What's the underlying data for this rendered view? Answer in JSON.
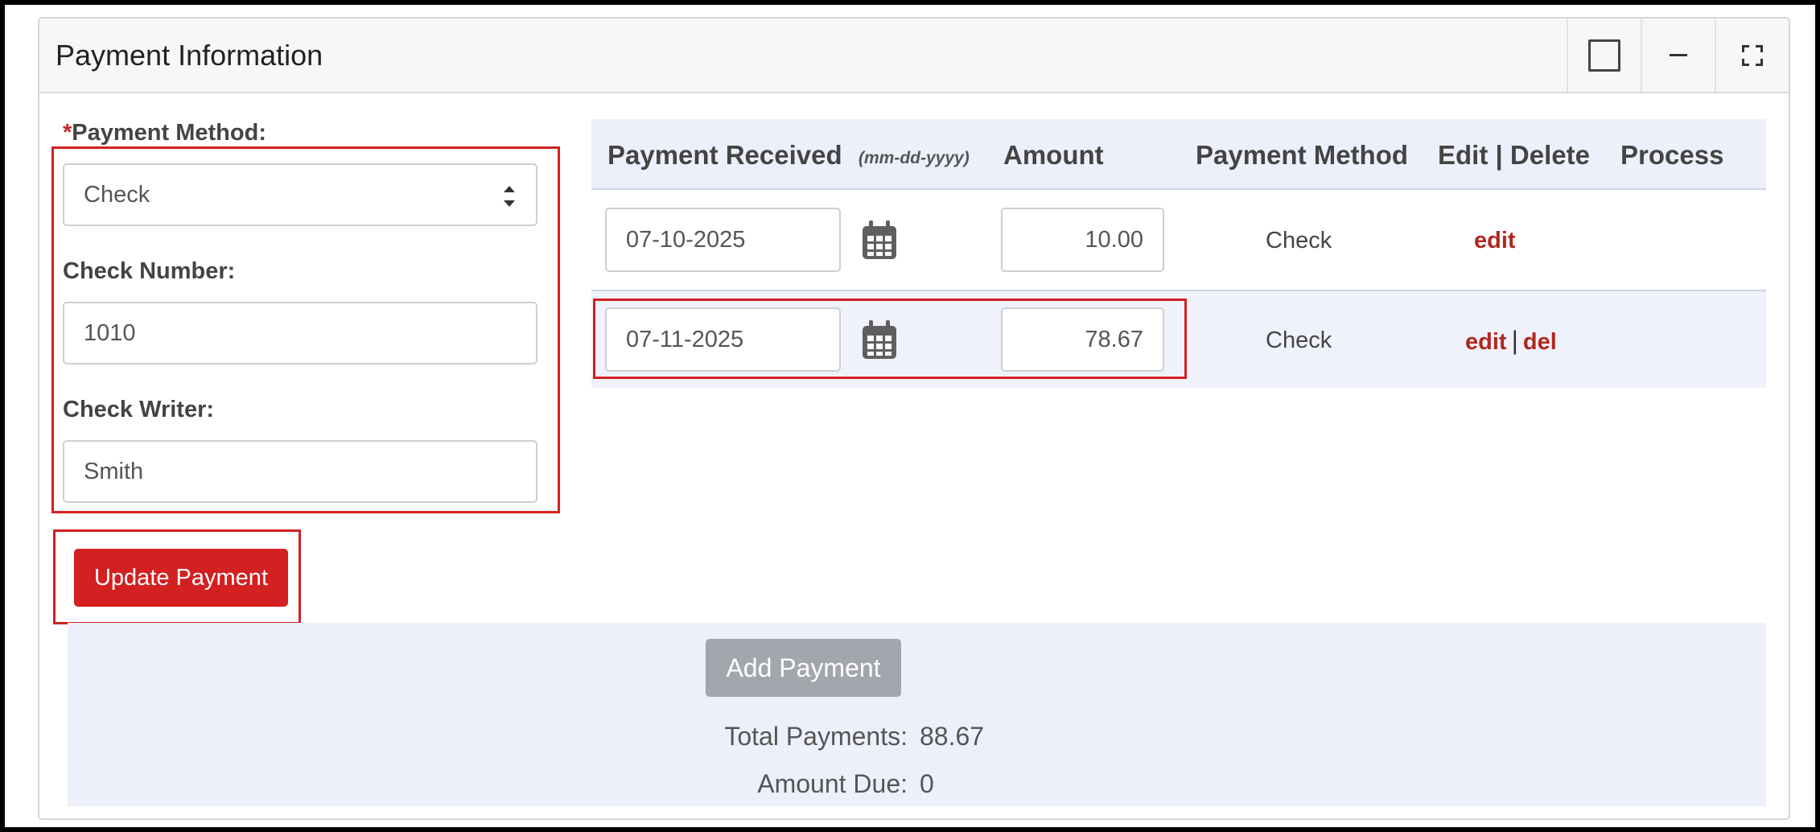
{
  "panel": {
    "title": "Payment Information"
  },
  "form": {
    "required_mark": "*",
    "payment_method_label": "Payment Method:",
    "payment_method_value": "Check",
    "check_number_label": "Check Number:",
    "check_number_value": "1010",
    "check_writer_label": "Check Writer:",
    "check_writer_value": "Smith",
    "update_button": "Update Payment"
  },
  "table": {
    "headers": {
      "received": "Payment Received",
      "date_format": "(mm-dd-yyyy)",
      "amount": "Amount",
      "method": "Payment Method",
      "edit_delete": "Edit | Delete",
      "process": "Process"
    },
    "rows": [
      {
        "date": "07-10-2025",
        "amount": "10.00",
        "method": "Check",
        "edit": "edit",
        "del": ""
      },
      {
        "date": "07-11-2025",
        "amount": "78.67",
        "method": "Check",
        "edit": "edit",
        "del": "del"
      }
    ]
  },
  "footer": {
    "add_button": "Add Payment",
    "total_label": "Total Payments:",
    "total_value": "88.67",
    "due_label": "Amount Due:",
    "due_value": "0"
  },
  "colors": {
    "accent_red": "#d32020",
    "link_red": "#b0281e",
    "band": "#edf0fb"
  },
  "icons": [
    "checkbox-icon",
    "minimize-icon",
    "fullscreen-icon",
    "select-caret-icon",
    "calendar-icon"
  ]
}
